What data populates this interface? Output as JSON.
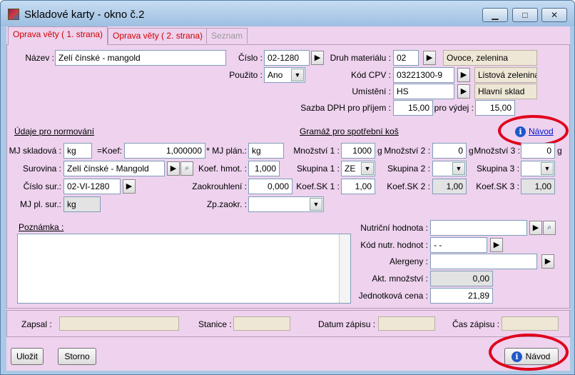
{
  "window": {
    "title": "Skladové karty - okno č.2",
    "minimize": "▁",
    "maximize": "□",
    "close": "✕"
  },
  "tabs": [
    {
      "label": "Oprava věty ( 1. strana)",
      "state": "active"
    },
    {
      "label": "Oprava věty ( 2. strana)",
      "state": "normal"
    },
    {
      "label": "Seznam",
      "state": "disabled"
    }
  ],
  "top": {
    "nazev_label": "Název :",
    "nazev_value": "Zelí čínské - mangold",
    "cislo_label": "Číslo :",
    "cislo_value": "02-1280",
    "druh_label": "Druh materiálu :",
    "druh_value": "02",
    "druh_name": "Ovoce, zelenina",
    "pouzito_label": "Použito :",
    "pouzito_value": "Ano",
    "cpv_label": "Kód CPV :",
    "cpv_value": "03221300-9",
    "cpv_name": "Listová zelenina",
    "umisteni_label": "Umístění :",
    "umisteni_value": "HS",
    "umisteni_name": "Hlavní sklad",
    "dph_label": "Sazba DPH pro příjem :",
    "dph_prijem": "15,00",
    "dph_vydej_label": "pro výdej :",
    "dph_vydej": "15,00"
  },
  "norm": {
    "section": "Údaje pro normování",
    "mj_skl_label": "MJ skladová :",
    "mj_skl_value": "kg",
    "koef_label": "=Koef:",
    "koef_value": "1,000000",
    "mj_plan_label": "* MJ plán.:",
    "mj_plan_value": "kg",
    "surovina_label": "Surovina :",
    "surovina_value": "Zelí čínské - Mangold",
    "koef_hmot_label": "Koef. hmot. :",
    "koef_hmot_value": "1,000",
    "cislo_sur_label": "Číslo sur.:",
    "cislo_sur_value": "02-VI-1280",
    "zaokr_label": "Zaokrouhlení :",
    "zaokr_value": "0,000",
    "mj_pl_sur_label": "MJ pl. sur.:",
    "mj_pl_sur_value": "kg",
    "zp_zaokr_label": "Zp.zaokr. :",
    "zp_zaokr_value": ""
  },
  "gramaz": {
    "section": "Gramáž pro spotřební koš",
    "navod": "Návod",
    "mnoz1_label": "Množství 1 :",
    "mnoz1_value": "1000",
    "mnoz1_unit": "g",
    "mnoz2_label": "Množství 2 :",
    "mnoz2_value": "0",
    "mnoz2_unit": "g",
    "mnoz3_label": "Množství 3 :",
    "mnoz3_value": "0",
    "mnoz3_unit": "g",
    "sk1_label": "Skupina 1 :",
    "sk1_value": "ZE",
    "sk2_label": "Skupina 2 :",
    "sk2_value": "",
    "sk3_label": "Skupina 3 :",
    "sk3_value": "",
    "ksk1_label": "Koef.SK 1 :",
    "ksk1_value": "1,00",
    "ksk2_label": "Koef.SK 2 :",
    "ksk2_value": "1,00",
    "ksk3_label": "Koef.SK 3 :",
    "ksk3_value": "1,00"
  },
  "notes": {
    "poznamka_label": "Poznámka :",
    "nutr_label": "Nutriční hodnota :",
    "nutr_value": "",
    "kod_nutr_label": "Kód nutr. hodnot :",
    "kod_nutr_value": "- -",
    "alergeny_label": "Alergeny :",
    "alergeny_value": "",
    "akt_label": "Akt. množství :",
    "akt_value": "0,00",
    "cena_label": "Jednotková cena :",
    "cena_value": "21,89"
  },
  "footer": {
    "zapsal_label": "Zapsal :",
    "zapsal_value": "",
    "stanice_label": "Stanice :",
    "stanice_value": "",
    "datum_label": "Datum zápisu :",
    "datum_value": "",
    "cas_label": "Čas zápisu :",
    "cas_value": ""
  },
  "buttons": {
    "ulozit": "Uložit",
    "storno": "Storno",
    "navod": "Návod"
  },
  "colors": {
    "panel": "#eed2ee",
    "highlight_ring": "#e0001a",
    "tab_text": "#d00000",
    "link": "#0018c8"
  }
}
